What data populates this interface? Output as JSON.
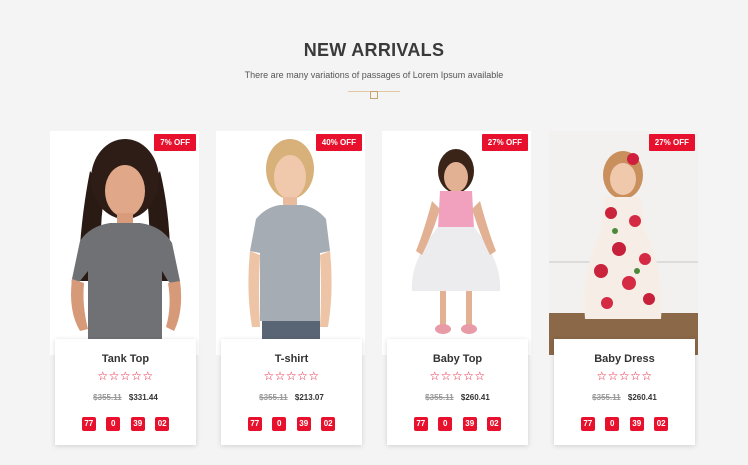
{
  "section": {
    "title": "NEW ARRIVALS",
    "subtitle": "There are many variations of passages of Lorem Ipsum available"
  },
  "colors": {
    "accent": "#e8112d",
    "divider": "#c9a46a"
  },
  "products": [
    {
      "name": "Tank Top",
      "badge": "7% OFF",
      "old_price": "$355.11",
      "new_price": "$331.44",
      "stars": "☆☆☆☆☆",
      "timer": [
        "77",
        "0",
        "39",
        "02"
      ]
    },
    {
      "name": "T-shirt",
      "badge": "40% OFF",
      "old_price": "$355.11",
      "new_price": "$213.07",
      "stars": "☆☆☆☆☆",
      "timer": [
        "77",
        "0",
        "39",
        "02"
      ]
    },
    {
      "name": "Baby Top",
      "badge": "27% OFF",
      "old_price": "$355.11",
      "new_price": "$260.41",
      "stars": "☆☆☆☆☆",
      "timer": [
        "77",
        "0",
        "39",
        "02"
      ]
    },
    {
      "name": "Baby Dress",
      "badge": "27% OFF",
      "old_price": "$355.11",
      "new_price": "$260.41",
      "stars": "☆☆☆☆☆",
      "timer": [
        "77",
        "0",
        "39",
        "02"
      ]
    }
  ]
}
